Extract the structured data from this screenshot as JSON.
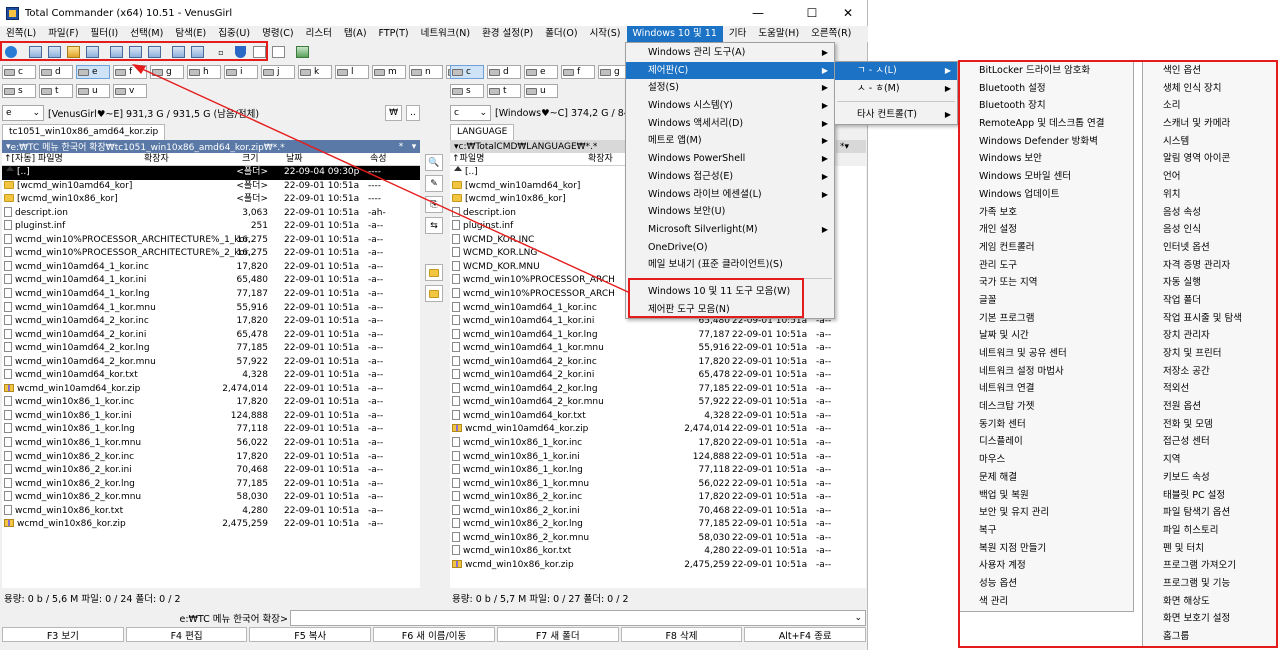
{
  "window": {
    "title": "Total Commander (x64) 10.51 - VenusGirl",
    "controls": [
      "—",
      "☐",
      "✕"
    ]
  },
  "menubar": [
    "왼쪽(L)",
    "파일(F)",
    "필터(I)",
    "선택(M)",
    "탐색(E)",
    "집중(U)",
    "명령(C)",
    "리스터",
    "탭(A)",
    "FTP(T)",
    "네트워크(N)",
    "환경 설정(P)",
    "폴더(O)",
    "시작(S)",
    "Windows 10 및 11",
    "기타",
    "도움말(H)",
    "오른쪽(R)"
  ],
  "left": {
    "drives_row1": [
      "c",
      "d",
      "e",
      "f",
      "g",
      "h",
      "i",
      "j",
      "k",
      "l",
      "m",
      "n",
      "r"
    ],
    "drives_row2": [
      "s",
      "t",
      "u",
      "v"
    ],
    "drive_combo": "e",
    "volume": "[VenusGirl♥~E]  931,3 G / 931,5 G (남음/전체)",
    "root_btn": "₩",
    "up_btn": "..",
    "tab": "tc1051_win10x86_amd64_kor.zip",
    "path": "e:₩TC 메뉴 한국어 확장₩tc1051_win10x86_amd64_kor.zip₩*.*",
    "path_star": "*",
    "headers": {
      "name": "↑[자동] 파일명",
      "ext": "확장자",
      "size": "크기",
      "date": "날짜",
      "attr": "속성"
    },
    "files": [
      {
        "icon": "up",
        "name": "[..]",
        "size": "<폴더>",
        "date": "22-09-04 09:30p",
        "attr": "----"
      },
      {
        "icon": "folder",
        "name": "[wcmd_win10amd64_kor]",
        "size": "<폴더>",
        "date": "22-09-01 10:51a",
        "attr": "----"
      },
      {
        "icon": "folder",
        "name": "[wcmd_win10x86_kor]",
        "size": "<폴더>",
        "date": "22-09-01 10:51a",
        "attr": "----"
      },
      {
        "icon": "file",
        "name": "descript.ion",
        "size": "3,063",
        "date": "22-09-01 10:51a",
        "attr": "-ah-"
      },
      {
        "icon": "file",
        "name": "pluginst.inf",
        "size": "251",
        "date": "22-09-01 10:51a",
        "attr": "-a--"
      },
      {
        "icon": "file",
        "name": "wcmd_win10%PROCESSOR_ARCHITECTURE%_1_kor..",
        "size": "16,275",
        "date": "22-09-01 10:51a",
        "attr": "-a--"
      },
      {
        "icon": "file",
        "name": "wcmd_win10%PROCESSOR_ARCHITECTURE%_2_kor..",
        "size": "16,275",
        "date": "22-09-01 10:51a",
        "attr": "-a--"
      },
      {
        "icon": "file",
        "name": "wcmd_win10amd64_1_kor.inc",
        "size": "17,820",
        "date": "22-09-01 10:51a",
        "attr": "-a--"
      },
      {
        "icon": "file",
        "name": "wcmd_win10amd64_1_kor.ini",
        "size": "65,480",
        "date": "22-09-01 10:51a",
        "attr": "-a--"
      },
      {
        "icon": "file",
        "name": "wcmd_win10amd64_1_kor.lng",
        "size": "77,187",
        "date": "22-09-01 10:51a",
        "attr": "-a--"
      },
      {
        "icon": "file",
        "name": "wcmd_win10amd64_1_kor.mnu",
        "size": "55,916",
        "date": "22-09-01 10:51a",
        "attr": "-a--"
      },
      {
        "icon": "file",
        "name": "wcmd_win10amd64_2_kor.inc",
        "size": "17,820",
        "date": "22-09-01 10:51a",
        "attr": "-a--"
      },
      {
        "icon": "file",
        "name": "wcmd_win10amd64_2_kor.ini",
        "size": "65,478",
        "date": "22-09-01 10:51a",
        "attr": "-a--"
      },
      {
        "icon": "file",
        "name": "wcmd_win10amd64_2_kor.lng",
        "size": "77,185",
        "date": "22-09-01 10:51a",
        "attr": "-a--"
      },
      {
        "icon": "file",
        "name": "wcmd_win10amd64_2_kor.mnu",
        "size": "57,922",
        "date": "22-09-01 10:51a",
        "attr": "-a--"
      },
      {
        "icon": "file",
        "name": "wcmd_win10amd64_kor.txt",
        "size": "4,328",
        "date": "22-09-01 10:51a",
        "attr": "-a--"
      },
      {
        "icon": "zip",
        "name": "wcmd_win10amd64_kor.zip",
        "size": "2,474,014",
        "date": "22-09-01 10:51a",
        "attr": "-a--"
      },
      {
        "icon": "file",
        "name": "wcmd_win10x86_1_kor.inc",
        "size": "17,820",
        "date": "22-09-01 10:51a",
        "attr": "-a--"
      },
      {
        "icon": "file",
        "name": "wcmd_win10x86_1_kor.ini",
        "size": "124,888",
        "date": "22-09-01 10:51a",
        "attr": "-a--"
      },
      {
        "icon": "file",
        "name": "wcmd_win10x86_1_kor.lng",
        "size": "77,118",
        "date": "22-09-01 10:51a",
        "attr": "-a--"
      },
      {
        "icon": "file",
        "name": "wcmd_win10x86_1_kor.mnu",
        "size": "56,022",
        "date": "22-09-01 10:51a",
        "attr": "-a--"
      },
      {
        "icon": "file",
        "name": "wcmd_win10x86_2_kor.inc",
        "size": "17,820",
        "date": "22-09-01 10:51a",
        "attr": "-a--"
      },
      {
        "icon": "file",
        "name": "wcmd_win10x86_2_kor.ini",
        "size": "70,468",
        "date": "22-09-01 10:51a",
        "attr": "-a--"
      },
      {
        "icon": "file",
        "name": "wcmd_win10x86_2_kor.lng",
        "size": "77,185",
        "date": "22-09-01 10:51a",
        "attr": "-a--"
      },
      {
        "icon": "file",
        "name": "wcmd_win10x86_2_kor.mnu",
        "size": "58,030",
        "date": "22-09-01 10:51a",
        "attr": "-a--"
      },
      {
        "icon": "file",
        "name": "wcmd_win10x86_kor.txt",
        "size": "4,280",
        "date": "22-09-01 10:51a",
        "attr": "-a--"
      },
      {
        "icon": "zip",
        "name": "wcmd_win10x86_kor.zip",
        "size": "2,475,259",
        "date": "22-09-01 10:51a",
        "attr": "-a--"
      }
    ],
    "status": "용량: 0 b / 5,6 M       파일: 0 / 24       폴더: 0 / 2"
  },
  "right": {
    "drives_row1": [
      "c",
      "d",
      "e",
      "f",
      "g"
    ],
    "drives_row2": [
      "s",
      "t",
      "u"
    ],
    "drive_combo": "c",
    "volume": "[Windows♥~C]  374,2 G / 84",
    "tab": "LANGUAGE",
    "path": "c:₩TotalCMD₩LANGUAGE₩*.*",
    "path_star": "*",
    "headers": {
      "name": "↑파일명",
      "ext": "확장자"
    },
    "files": [
      {
        "icon": "up",
        "name": "[..]",
        "size": "",
        "date": "",
        "attr": ""
      },
      {
        "icon": "folder",
        "name": "[wcmd_win10amd64_kor]",
        "size": "",
        "date": "",
        "attr": ""
      },
      {
        "icon": "folder",
        "name": "[wcmd_win10x86_kor]",
        "size": "",
        "date": "",
        "attr": ""
      },
      {
        "icon": "file",
        "name": "descript.ion",
        "size": "",
        "date": "",
        "attr": ""
      },
      {
        "icon": "file",
        "name": "pluginst.inf",
        "size": "",
        "date": "",
        "attr": ""
      },
      {
        "icon": "file",
        "name": "WCMD_KOR.INC",
        "size": "",
        "date": "",
        "attr": ""
      },
      {
        "icon": "file",
        "name": "WCMD_KOR.LNG",
        "size": "",
        "date": "",
        "attr": ""
      },
      {
        "icon": "file",
        "name": "WCMD_KOR.MNU",
        "size": "",
        "date": "",
        "attr": ""
      },
      {
        "icon": "file",
        "name": "wcmd_win10%PROCESSOR_ARCH",
        "size": "",
        "date": "",
        "attr": ""
      },
      {
        "icon": "file",
        "name": "wcmd_win10%PROCESSOR_ARCH",
        "size": "",
        "date": "",
        "attr": ""
      },
      {
        "icon": "file",
        "name": "wcmd_win10amd64_1_kor.inc",
        "size": "",
        "date": "",
        "attr": ""
      },
      {
        "icon": "file",
        "name": "wcmd_win10amd64_1_kor.ini",
        "size": "65,480",
        "date": "22-09-01 10:51a",
        "attr": "-a--"
      },
      {
        "icon": "file",
        "name": "wcmd_win10amd64_1_kor.lng",
        "size": "77,187",
        "date": "22-09-01 10:51a",
        "attr": "-a--"
      },
      {
        "icon": "file",
        "name": "wcmd_win10amd64_1_kor.mnu",
        "size": "55,916",
        "date": "22-09-01 10:51a",
        "attr": "-a--"
      },
      {
        "icon": "file",
        "name": "wcmd_win10amd64_2_kor.inc",
        "size": "17,820",
        "date": "22-09-01 10:51a",
        "attr": "-a--"
      },
      {
        "icon": "file",
        "name": "wcmd_win10amd64_2_kor.ini",
        "size": "65,478",
        "date": "22-09-01 10:51a",
        "attr": "-a--"
      },
      {
        "icon": "file",
        "name": "wcmd_win10amd64_2_kor.lng",
        "size": "77,185",
        "date": "22-09-01 10:51a",
        "attr": "-a--"
      },
      {
        "icon": "file",
        "name": "wcmd_win10amd64_2_kor.mnu",
        "size": "57,922",
        "date": "22-09-01 10:51a",
        "attr": "-a--"
      },
      {
        "icon": "file",
        "name": "wcmd_win10amd64_kor.txt",
        "size": "4,328",
        "date": "22-09-01 10:51a",
        "attr": "-a--"
      },
      {
        "icon": "zip",
        "name": "wcmd_win10amd64_kor.zip",
        "size": "2,474,014",
        "date": "22-09-01 10:51a",
        "attr": "-a--"
      },
      {
        "icon": "file",
        "name": "wcmd_win10x86_1_kor.inc",
        "size": "17,820",
        "date": "22-09-01 10:51a",
        "attr": "-a--"
      },
      {
        "icon": "file",
        "name": "wcmd_win10x86_1_kor.ini",
        "size": "124,888",
        "date": "22-09-01 10:51a",
        "attr": "-a--"
      },
      {
        "icon": "file",
        "name": "wcmd_win10x86_1_kor.lng",
        "size": "77,118",
        "date": "22-09-01 10:51a",
        "attr": "-a--"
      },
      {
        "icon": "file",
        "name": "wcmd_win10x86_1_kor.mnu",
        "size": "56,022",
        "date": "22-09-01 10:51a",
        "attr": "-a--"
      },
      {
        "icon": "file",
        "name": "wcmd_win10x86_2_kor.inc",
        "size": "17,820",
        "date": "22-09-01 10:51a",
        "attr": "-a--"
      },
      {
        "icon": "file",
        "name": "wcmd_win10x86_2_kor.ini",
        "size": "70,468",
        "date": "22-09-01 10:51a",
        "attr": "-a--"
      },
      {
        "icon": "file",
        "name": "wcmd_win10x86_2_kor.lng",
        "size": "77,185",
        "date": "22-09-01 10:51a",
        "attr": "-a--"
      },
      {
        "icon": "file",
        "name": "wcmd_win10x86_2_kor.mnu",
        "size": "58,030",
        "date": "22-09-01 10:51a",
        "attr": "-a--"
      },
      {
        "icon": "file",
        "name": "wcmd_win10x86_kor.txt",
        "size": "4,280",
        "date": "22-09-01 10:51a",
        "attr": "-a--"
      },
      {
        "icon": "zip",
        "name": "wcmd_win10x86_kor.zip",
        "size": "2,475,259",
        "date": "22-09-01 10:51a",
        "attr": "-a--"
      }
    ],
    "status": "용량: 0 b / 5,7 M       파일: 0 / 27       폴더: 0 / 2"
  },
  "cmdline": {
    "prompt": "e:₩TC 메뉴 한국어 확장>"
  },
  "fkeys": [
    "F3 보기",
    "F4 편집",
    "F5 복사",
    "F6 새 이름/이동",
    "F7 새 폴더",
    "F8 삭제",
    "Alt+F4 종료"
  ],
  "menu_win": {
    "items": [
      {
        "label": "Windows 관리 도구(A)",
        "sub": true
      },
      {
        "label": "제어판(C)",
        "sub": true,
        "hl": true
      },
      {
        "label": "설정(S)",
        "sub": true
      },
      {
        "label": "Windows 시스템(Y)",
        "sub": true
      },
      {
        "label": "Windows 액세서리(D)",
        "sub": true
      },
      {
        "label": "메트로 앱(M)",
        "sub": true
      },
      {
        "label": "Windows PowerShell",
        "sub": true
      },
      {
        "label": "Windows 접근성(E)",
        "sub": true
      },
      {
        "label": "Windows 라이브 에센셜(L)",
        "sub": true
      },
      {
        "label": "Windows 보안(U)",
        "sub": false
      },
      {
        "label": "Microsoft Silverlight(M)",
        "sub": true
      },
      {
        "label": "OneDrive(O)",
        "sub": false
      },
      {
        "label": "메일 보내기 (표준 클라이언트)(S)",
        "sub": false
      }
    ],
    "bottom": [
      "Windows 10 및 11 도구 모음(W)",
      "제어판 도구 모음(N)"
    ]
  },
  "menu_cp": {
    "items": [
      {
        "label": "ㄱ - ㅅ(L)",
        "sub": true,
        "hl": true
      },
      {
        "label": "ㅅ - ㅎ(M)",
        "sub": true
      },
      {
        "label": "타사 컨트롤(T)",
        "sub": true
      }
    ]
  },
  "cp_col1": [
    "BitLocker 드라이브 암호화",
    "Bluetooth 설정",
    "Bluetooth 장치",
    "RemoteApp 및 데스크톱 연결",
    "Windows Defender 방화벽",
    "Windows 보안",
    "Windows 모바일 센터",
    "Windows 업데이트",
    "가족 보호",
    "개인 설정",
    "게임 컨트롤러",
    "관리 도구",
    "국가 또는 지역",
    "글꼴",
    "기본 프로그램",
    "날짜 및 시간",
    "네트워크 및 공유 센터",
    "네트워크 설정 마법사",
    "네트워크 연결",
    "데스크탑 가젯",
    "동기화 센터",
    "디스플레이",
    "마우스",
    "문제 해결",
    "백업 및 복원",
    "보안 및 유지 관리",
    "복구",
    "복원 지점 만들기",
    "사용자 계정",
    "성능 옵션",
    "색 관리"
  ],
  "cp_col2": [
    "색인 옵션",
    "생체 인식 장치",
    "소리",
    "스캐너 및 카메라",
    "시스템",
    "알림 영역 아이콘",
    "언어",
    "위치",
    "음성 속성",
    "음성 인식",
    "인터넷 옵션",
    "자격 증명 관리자",
    "자동 실행",
    "작업 폴더",
    "작업 표시줄 및 탐색",
    "장치 관리자",
    "장치 및 프린터",
    "저장소 공간",
    "적외선",
    "전원 옵션",
    "전화 및 모뎀",
    "접근성 센터",
    "지역",
    "키보드 속성",
    "태블릿 PC 설정",
    "파일 탐색기 옵션",
    "파일 히스토리",
    "펜 및 터치",
    "프로그램 가져오기",
    "프로그램 및 기능",
    "화면 해상도",
    "화면 보호기 설정",
    "홈그룹"
  ],
  "colors": {
    "accent": "#1c72c4",
    "annotation": "#e41c1c",
    "active_path": "#5b79a6"
  }
}
